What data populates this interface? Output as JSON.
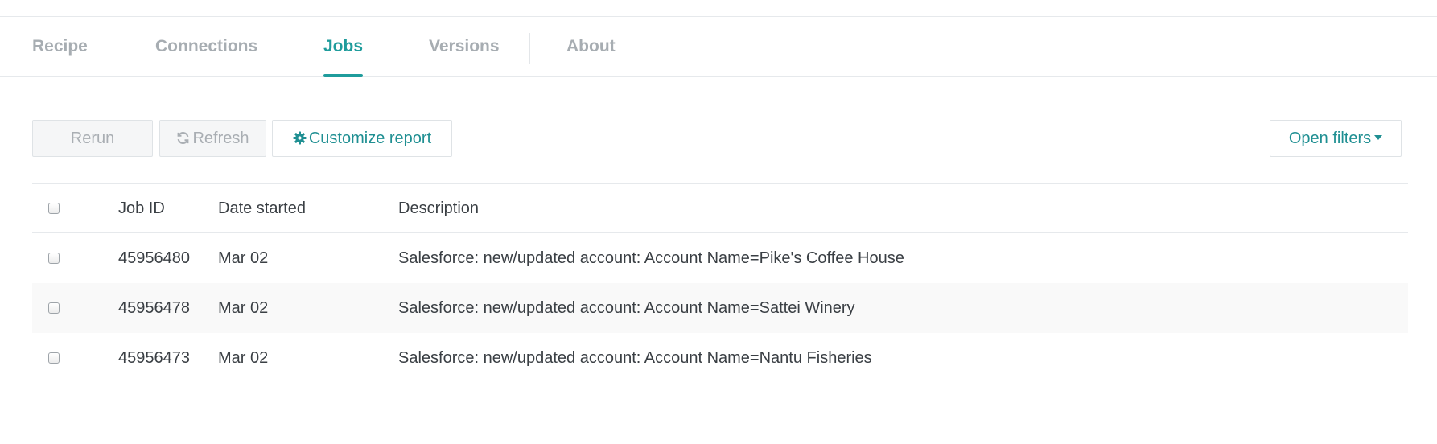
{
  "tabs": [
    {
      "label": "Recipe",
      "active": false
    },
    {
      "label": "Connections",
      "active": false
    },
    {
      "label": "Jobs",
      "active": true
    },
    {
      "label": "Versions",
      "active": false
    },
    {
      "label": "About",
      "active": false
    }
  ],
  "toolbar": {
    "rerun_label": "Rerun",
    "refresh_icon": "refresh-icon",
    "refresh_label": "Refresh",
    "customize_icon": "gear-icon",
    "customize_label": "Customize report",
    "filters_label": "Open filters",
    "filters_icon": "caret-down-icon"
  },
  "table": {
    "columns": [
      "Job ID",
      "Date started",
      "Description"
    ],
    "rows": [
      {
        "id": "45956480",
        "date": "Mar 02",
        "description": "Salesforce: new/updated account: Account Name=Pike's Coffee House"
      },
      {
        "id": "45956478",
        "date": "Mar 02",
        "description": "Salesforce: new/updated account: Account Name=Sattei Winery"
      },
      {
        "id": "45956473",
        "date": "Mar 02",
        "description": "Salesforce: new/updated account: Account Name=Nantu Fisheries"
      }
    ]
  },
  "colors": {
    "accent": "#1f9c9c",
    "muted_text": "#a7adb2",
    "row_stripe": "#f9f9f9"
  }
}
